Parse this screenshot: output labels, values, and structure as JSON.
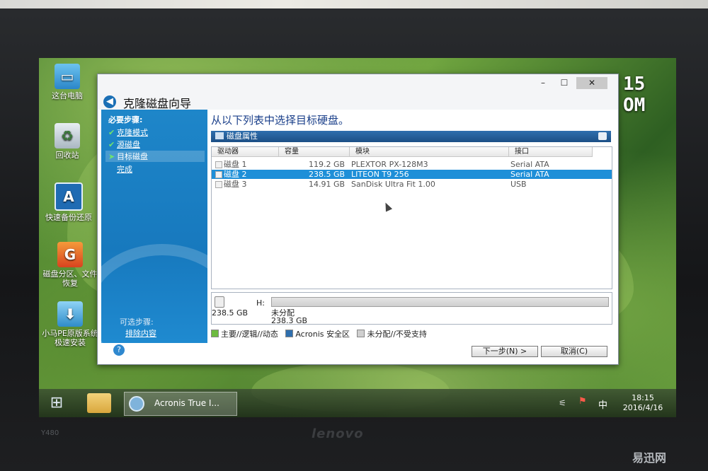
{
  "desktop": {
    "icons": [
      {
        "label": "这台电脑",
        "icon": "computer-icon"
      },
      {
        "label": "回收站",
        "icon": "recycle-bin-icon"
      },
      {
        "label": "快速备份还原",
        "icon": "acronis-icon"
      },
      {
        "label": "磁盘分区、文件恢复",
        "icon": "diskgenius-icon"
      },
      {
        "label": "小马PE原版系统极速安装",
        "icon": "installer-icon"
      }
    ],
    "clock_digits": "15\nOM"
  },
  "dialog": {
    "title": "克隆磁盘向导",
    "window_controls": {
      "minimize": "–",
      "maximize": "☐",
      "close": "✕"
    },
    "sidebar": {
      "required_heading": "必要步骤:",
      "steps": [
        {
          "label": "克隆模式",
          "done": true
        },
        {
          "label": "源磁盘",
          "done": true
        },
        {
          "label": "目标磁盘",
          "current": true
        },
        {
          "label": "完成",
          "done": false
        }
      ],
      "optional_heading": "可选步骤:",
      "exclude_item": "排除内容"
    },
    "main_title": "从以下列表中选择目标硬盘。",
    "panel_header": "磁盘属性",
    "table": {
      "columns": [
        "驱动器",
        "容量",
        "模块",
        "接口"
      ],
      "rows": [
        {
          "drive": "磁盘 1",
          "capacity": "119.2 GB",
          "model": "PLEXTOR PX-128M3",
          "interface": "Serial ATA",
          "selected": false
        },
        {
          "drive": "磁盘 2",
          "capacity": "238.5 GB",
          "model": "LITEON T9 256",
          "interface": "Serial ATA",
          "selected": true
        },
        {
          "drive": "磁盘 3",
          "capacity": "14.91 GB",
          "model": "SanDisk Ultra Fit 1.00",
          "interface": "USB",
          "selected": false
        }
      ]
    },
    "disk_map": {
      "disk_size": "238.5 GB",
      "partition_letter": "H:",
      "partition_label": "未分配",
      "partition_size": "238.3 GB"
    },
    "legend": [
      {
        "label": "主要//逻辑//动态",
        "color": "#6dbb3f"
      },
      {
        "label": "Acronis 安全区",
        "color": "#2f6fae"
      },
      {
        "label": "未分配//不受支持",
        "color": "#cfcfcf"
      }
    ],
    "buttons": {
      "next": "下一步(N) >",
      "cancel": "取消(C)"
    }
  },
  "taskbar": {
    "app_label": "Acronis True I...",
    "ime": "中",
    "time": "18:15",
    "date": "2016/4/16"
  },
  "hardware": {
    "brand": "lenovo",
    "model": "Y480"
  },
  "watermark": "易迅网"
}
